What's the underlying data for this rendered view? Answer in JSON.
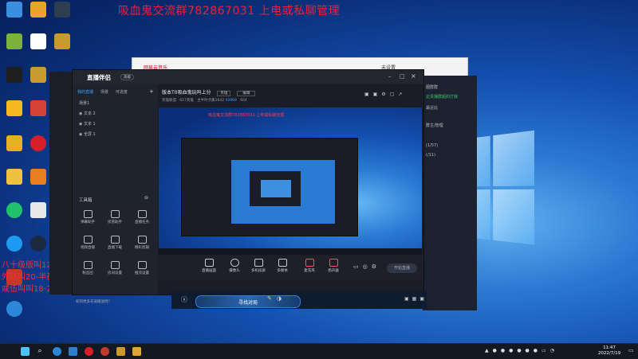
{
  "banner_text": "吸血鬼交流群782867031 上电或私聊管理",
  "left_notes": [
    "八十级版叫12-20",
    "外联叫20-半夜4",
    "咸伍叫叫18-22"
  ],
  "desktop_icons": [
    {
      "label": "Microsoft Edge",
      "color": "#2c87d8"
    },
    {
      "label": "QQ",
      "color": "#1d9bf0"
    },
    {
      "label": "Steam",
      "color": "#1b2a40"
    },
    {
      "label": "QQ音乐",
      "color": "#21c06b"
    },
    {
      "label": "网易云音乐",
      "color": "#d71f2a"
    },
    {
      "label": "英雄联盟",
      "color": "#c99a2e"
    },
    {
      "label": "WeGame",
      "color": "#d53a1d"
    }
  ],
  "background_window": {
    "title": "网易云音乐",
    "right_text": "未设置"
  },
  "background_panel_rows": [
    "圈群群",
    "云贵播群超的打我",
    "最近比",
    "群主/管理",
    "(1/57)",
    "(/11)"
  ],
  "app": {
    "title": "直播伴侣",
    "badge": "高级",
    "tabs": [
      "我的直播",
      "场景",
      "可进度"
    ],
    "scenes": [
      "场景1",
      "文本 2",
      "文本 1",
      "全屏 1"
    ],
    "tools_title": "工具箱",
    "tools": [
      "弹幕助手",
      "房管助手",
      "直播任务",
      "视频直播",
      "直播下载",
      "精彩剪辑",
      "粉丝团",
      "房间设置",
      "推流设置"
    ],
    "hint": "如何更多充值赠送挡？"
  },
  "room": {
    "title": "版本T0吸血鬼玩吗上分",
    "category": "英雄",
    "edit": "编辑",
    "meta_left": "英雄联盟 · 617英雄",
    "meta_mid": "主半时点集1642",
    "meta_id": "92969",
    "meta_right": "664"
  },
  "preview_red_text": "吸血鬼交流群782867031 上电或私聊管理",
  "controls": [
    "直播画面",
    "摄像头",
    "多机投屏",
    "多媒体",
    "麦克风",
    "扬声器"
  ],
  "live_button": "开始直播",
  "stream_bar_label": "寻找对局",
  "clock": {
    "time": "11:47",
    "date": "2022/7/19"
  },
  "taskbar_icons": [
    {
      "name": "windows-start",
      "color": "#4cc2ff"
    },
    {
      "name": "search",
      "color": "#ffffff"
    },
    {
      "name": "edge",
      "color": "#2c87d8"
    },
    {
      "name": "store",
      "color": "#2d7dd2"
    },
    {
      "name": "netease",
      "color": "#d71f2a"
    },
    {
      "name": "league",
      "color": "#c99a2e"
    },
    {
      "name": "app",
      "color": "#c0392b"
    },
    {
      "name": "league-2",
      "color": "#e0a530"
    }
  ]
}
